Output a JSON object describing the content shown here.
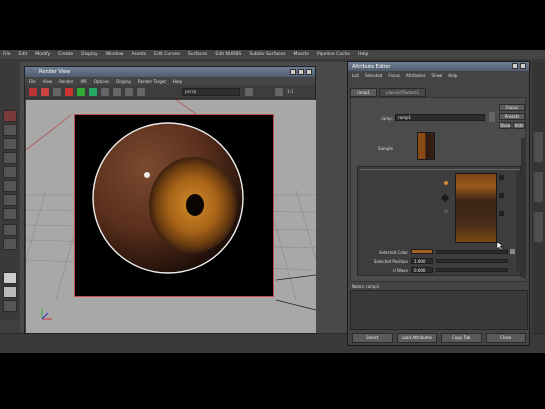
{
  "main_menu": [
    "File",
    "Edit",
    "Modify",
    "Create",
    "Display",
    "Window",
    "Assets",
    "Edit Curves",
    "Surfaces",
    "Edit NURBS",
    "Subdiv Surfaces",
    "Muscle",
    "Pipeline Cache",
    "Help"
  ],
  "render_view": {
    "title": "Render View",
    "menu": [
      "File",
      "View",
      "Render",
      "IPR",
      "Options",
      "Display",
      "Render Target",
      "Help"
    ],
    "camera_dropdown": "persp",
    "size_readout": "1:1"
  },
  "attribute_editor": {
    "title": "Attribute Editor",
    "menu": [
      "List",
      "Selected",
      "Focus",
      "Attributes",
      "Show",
      "Help"
    ],
    "tabs": [
      "ramp1",
      "place2dTexture1"
    ],
    "ramp_field_label": "ramp:",
    "ramp_field_value": "ramp1",
    "focus_button": "Focus",
    "presets_button": "Presets",
    "show_button": "Show",
    "hide_button": "Hide",
    "sample_label": "Sample",
    "selected_color_label": "Selected Color",
    "selected_position_label": "Selected Position",
    "selected_position_value": "1.000",
    "u_wave_label": "U Wave",
    "u_wave_value": "0.000",
    "notes_label": "Notes: ramp1",
    "buttons": [
      "Select",
      "Load Attributes",
      "Copy Tab",
      "Close"
    ]
  },
  "colors": {
    "title_bar": "#5d6b7e",
    "selected_color": "#a7611f"
  }
}
